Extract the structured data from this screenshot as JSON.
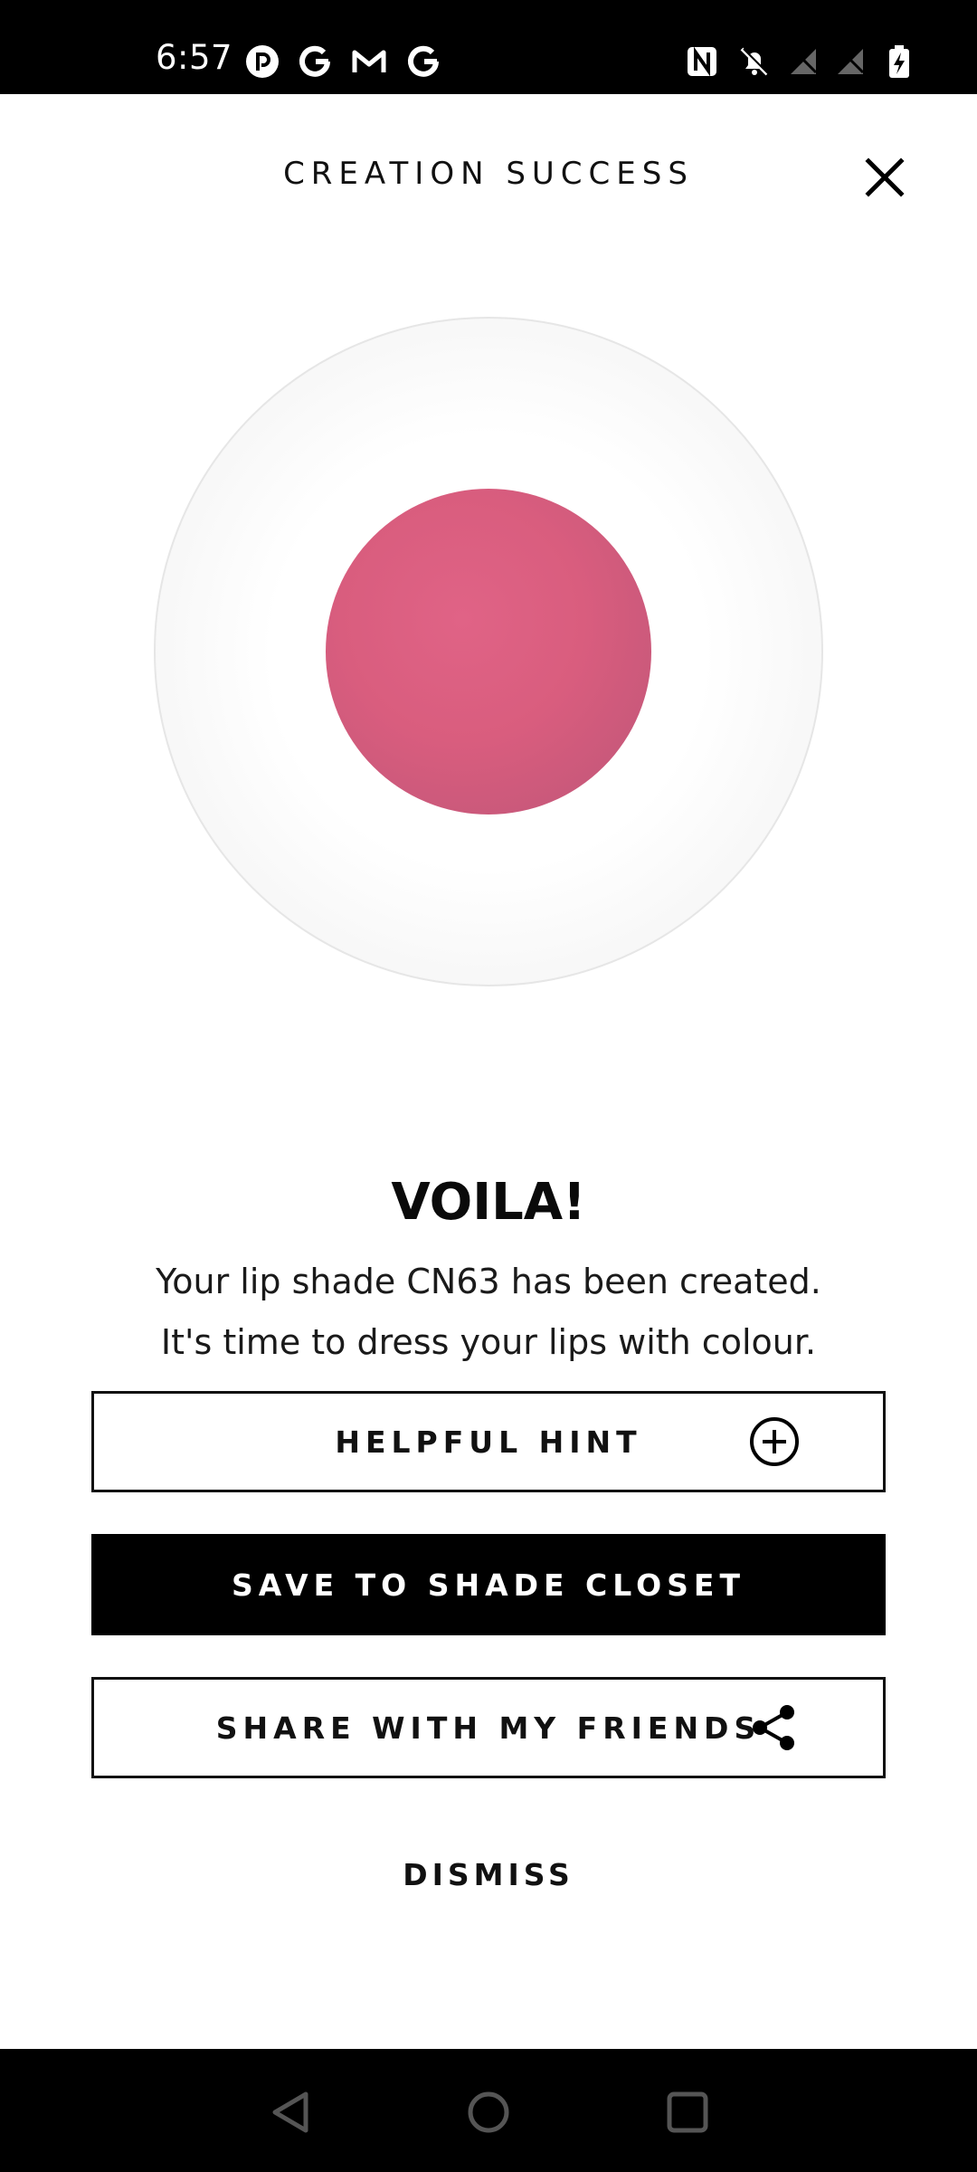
{
  "status_bar": {
    "time": "6:57",
    "left_icons": [
      "pocket-casts-icon",
      "google-icon",
      "gmail-icon",
      "google-icon"
    ],
    "right_icons": [
      "nfc-icon",
      "bell-off-icon",
      "no-signal-icon",
      "no-signal-icon",
      "battery-charging-icon"
    ]
  },
  "header": {
    "title": "CREATION SUCCESS",
    "close_icon": "close-icon"
  },
  "swatch": {
    "color": "#d95d7e"
  },
  "message": {
    "heading": "VOILA!",
    "line1": "Your lip shade CN63 has been created.",
    "line2": "It's time to dress your lips with colour."
  },
  "buttons": {
    "hint_label": "HELPFUL HINT",
    "hint_icon": "plus-circle-icon",
    "save_label": "SAVE TO SHADE CLOSET",
    "share_label": "SHARE WITH MY FRIENDS",
    "share_icon": "share-icon",
    "dismiss_label": "DISMISS"
  },
  "nav_bar": {
    "icons": [
      "back-icon",
      "home-icon",
      "recents-icon"
    ]
  }
}
